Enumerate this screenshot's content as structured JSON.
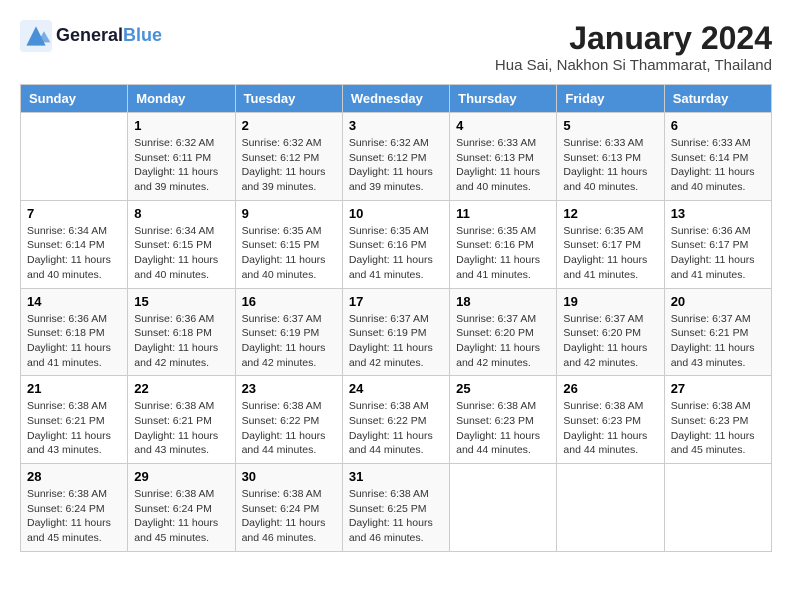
{
  "header": {
    "logo_text_general": "General",
    "logo_text_blue": "Blue",
    "month_year": "January 2024",
    "location": "Hua Sai, Nakhon Si Thammarat, Thailand"
  },
  "days_of_week": [
    "Sunday",
    "Monday",
    "Tuesday",
    "Wednesday",
    "Thursday",
    "Friday",
    "Saturday"
  ],
  "weeks": [
    [
      {
        "day": "",
        "info": ""
      },
      {
        "day": "1",
        "info": "Sunrise: 6:32 AM\nSunset: 6:11 PM\nDaylight: 11 hours\nand 39 minutes."
      },
      {
        "day": "2",
        "info": "Sunrise: 6:32 AM\nSunset: 6:12 PM\nDaylight: 11 hours\nand 39 minutes."
      },
      {
        "day": "3",
        "info": "Sunrise: 6:32 AM\nSunset: 6:12 PM\nDaylight: 11 hours\nand 39 minutes."
      },
      {
        "day": "4",
        "info": "Sunrise: 6:33 AM\nSunset: 6:13 PM\nDaylight: 11 hours\nand 40 minutes."
      },
      {
        "day": "5",
        "info": "Sunrise: 6:33 AM\nSunset: 6:13 PM\nDaylight: 11 hours\nand 40 minutes."
      },
      {
        "day": "6",
        "info": "Sunrise: 6:33 AM\nSunset: 6:14 PM\nDaylight: 11 hours\nand 40 minutes."
      }
    ],
    [
      {
        "day": "7",
        "info": "Sunrise: 6:34 AM\nSunset: 6:14 PM\nDaylight: 11 hours\nand 40 minutes."
      },
      {
        "day": "8",
        "info": "Sunrise: 6:34 AM\nSunset: 6:15 PM\nDaylight: 11 hours\nand 40 minutes."
      },
      {
        "day": "9",
        "info": "Sunrise: 6:35 AM\nSunset: 6:15 PM\nDaylight: 11 hours\nand 40 minutes."
      },
      {
        "day": "10",
        "info": "Sunrise: 6:35 AM\nSunset: 6:16 PM\nDaylight: 11 hours\nand 41 minutes."
      },
      {
        "day": "11",
        "info": "Sunrise: 6:35 AM\nSunset: 6:16 PM\nDaylight: 11 hours\nand 41 minutes."
      },
      {
        "day": "12",
        "info": "Sunrise: 6:35 AM\nSunset: 6:17 PM\nDaylight: 11 hours\nand 41 minutes."
      },
      {
        "day": "13",
        "info": "Sunrise: 6:36 AM\nSunset: 6:17 PM\nDaylight: 11 hours\nand 41 minutes."
      }
    ],
    [
      {
        "day": "14",
        "info": "Sunrise: 6:36 AM\nSunset: 6:18 PM\nDaylight: 11 hours\nand 41 minutes."
      },
      {
        "day": "15",
        "info": "Sunrise: 6:36 AM\nSunset: 6:18 PM\nDaylight: 11 hours\nand 42 minutes."
      },
      {
        "day": "16",
        "info": "Sunrise: 6:37 AM\nSunset: 6:19 PM\nDaylight: 11 hours\nand 42 minutes."
      },
      {
        "day": "17",
        "info": "Sunrise: 6:37 AM\nSunset: 6:19 PM\nDaylight: 11 hours\nand 42 minutes."
      },
      {
        "day": "18",
        "info": "Sunrise: 6:37 AM\nSunset: 6:20 PM\nDaylight: 11 hours\nand 42 minutes."
      },
      {
        "day": "19",
        "info": "Sunrise: 6:37 AM\nSunset: 6:20 PM\nDaylight: 11 hours\nand 42 minutes."
      },
      {
        "day": "20",
        "info": "Sunrise: 6:37 AM\nSunset: 6:21 PM\nDaylight: 11 hours\nand 43 minutes."
      }
    ],
    [
      {
        "day": "21",
        "info": "Sunrise: 6:38 AM\nSunset: 6:21 PM\nDaylight: 11 hours\nand 43 minutes."
      },
      {
        "day": "22",
        "info": "Sunrise: 6:38 AM\nSunset: 6:21 PM\nDaylight: 11 hours\nand 43 minutes."
      },
      {
        "day": "23",
        "info": "Sunrise: 6:38 AM\nSunset: 6:22 PM\nDaylight: 11 hours\nand 44 minutes."
      },
      {
        "day": "24",
        "info": "Sunrise: 6:38 AM\nSunset: 6:22 PM\nDaylight: 11 hours\nand 44 minutes."
      },
      {
        "day": "25",
        "info": "Sunrise: 6:38 AM\nSunset: 6:23 PM\nDaylight: 11 hours\nand 44 minutes."
      },
      {
        "day": "26",
        "info": "Sunrise: 6:38 AM\nSunset: 6:23 PM\nDaylight: 11 hours\nand 44 minutes."
      },
      {
        "day": "27",
        "info": "Sunrise: 6:38 AM\nSunset: 6:23 PM\nDaylight: 11 hours\nand 45 minutes."
      }
    ],
    [
      {
        "day": "28",
        "info": "Sunrise: 6:38 AM\nSunset: 6:24 PM\nDaylight: 11 hours\nand 45 minutes."
      },
      {
        "day": "29",
        "info": "Sunrise: 6:38 AM\nSunset: 6:24 PM\nDaylight: 11 hours\nand 45 minutes."
      },
      {
        "day": "30",
        "info": "Sunrise: 6:38 AM\nSunset: 6:24 PM\nDaylight: 11 hours\nand 46 minutes."
      },
      {
        "day": "31",
        "info": "Sunrise: 6:38 AM\nSunset: 6:25 PM\nDaylight: 11 hours\nand 46 minutes."
      },
      {
        "day": "",
        "info": ""
      },
      {
        "day": "",
        "info": ""
      },
      {
        "day": "",
        "info": ""
      }
    ]
  ]
}
